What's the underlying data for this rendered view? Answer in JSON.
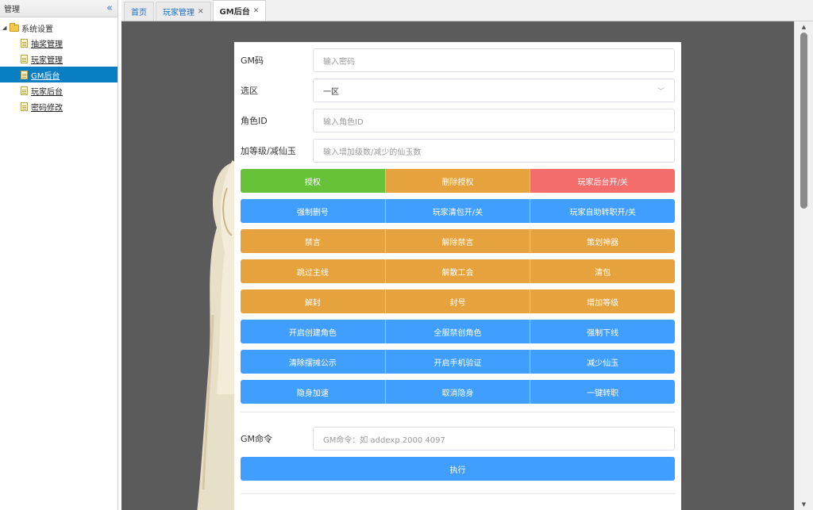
{
  "sidebar": {
    "title": "管理",
    "tree_root": "系统设置",
    "items": [
      {
        "label": "抽奖管理"
      },
      {
        "label": "玩家管理"
      },
      {
        "label": "GM后台"
      },
      {
        "label": "玩家后台"
      },
      {
        "label": "密码修改"
      }
    ],
    "active_index": 2
  },
  "tabs": [
    {
      "label": "首页",
      "closable": false
    },
    {
      "label": "玩家管理",
      "closable": true
    },
    {
      "label": "GM后台",
      "closable": true
    }
  ],
  "form": {
    "gm_code": {
      "label": "GM码",
      "placeholder": "输入密码"
    },
    "zone": {
      "label": "选区",
      "value": "一区"
    },
    "role_id": {
      "label": "角色ID",
      "placeholder": "输入角色ID"
    },
    "level": {
      "label": "加等级/减仙玉",
      "placeholder": "输入增加级数/减少的仙玉数"
    }
  },
  "button_rows": [
    [
      {
        "label": "授权",
        "color": "green"
      },
      {
        "label": "删除授权",
        "color": "orange"
      },
      {
        "label": "玩家后台开/关",
        "color": "red"
      }
    ],
    [
      {
        "label": "强制删号",
        "color": "blue"
      },
      {
        "label": "玩家清包开/关",
        "color": "blue"
      },
      {
        "label": "玩家自助转职开/关",
        "color": "blue"
      }
    ],
    [
      {
        "label": "禁言",
        "color": "orange"
      },
      {
        "label": "解除禁言",
        "color": "orange"
      },
      {
        "label": "策划神器",
        "color": "orange"
      }
    ],
    [
      {
        "label": "跳过主线",
        "color": "orange"
      },
      {
        "label": "解散工会",
        "color": "orange"
      },
      {
        "label": "清包",
        "color": "orange"
      }
    ],
    [
      {
        "label": "解封",
        "color": "orange"
      },
      {
        "label": "封号",
        "color": "orange"
      },
      {
        "label": "增加等级",
        "color": "orange"
      }
    ],
    [
      {
        "label": "开启创建角色",
        "color": "blue"
      },
      {
        "label": "全服禁创角色",
        "color": "blue"
      },
      {
        "label": "强制下线",
        "color": "blue"
      }
    ],
    [
      {
        "label": "清除摆摊公示",
        "color": "blue"
      },
      {
        "label": "开启手机验证",
        "color": "blue"
      },
      {
        "label": "减少仙玉",
        "color": "blue"
      }
    ],
    [
      {
        "label": "隐身加速",
        "color": "blue"
      },
      {
        "label": "取消隐身",
        "color": "blue"
      },
      {
        "label": "一键转职",
        "color": "blue"
      }
    ]
  ],
  "command": {
    "label": "GM命令",
    "placeholder": "GM命令：如 addexp 2000 4097",
    "execute_label": "执行"
  },
  "colors": {
    "green": "#67c23a",
    "orange": "#e6a23c",
    "red": "#f56c6c",
    "blue": "#409eff",
    "sidebar_active": "#0a7ec2"
  }
}
